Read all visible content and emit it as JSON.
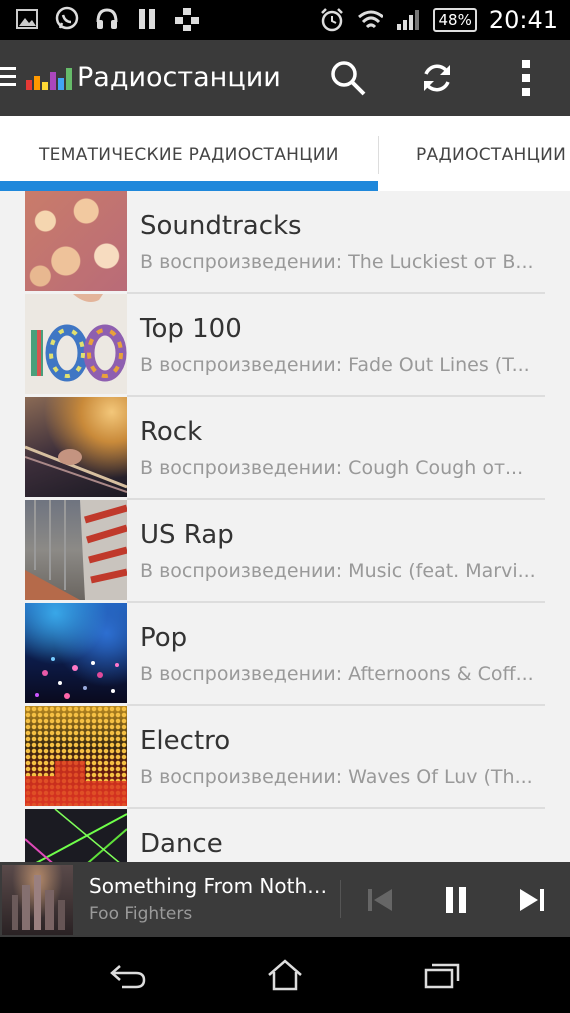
{
  "status_bar": {
    "icons": [
      "image-icon",
      "viber-icon",
      "headphones-icon",
      "pause-icon",
      "network-icon",
      "alarm-icon",
      "wifi-icon",
      "signal-icon"
    ],
    "battery": "48%",
    "time": "20:41"
  },
  "app_bar": {
    "title": "Радиостанции",
    "icons": [
      "menu-icon",
      "deezer-logo",
      "search-icon",
      "refresh-icon",
      "overflow-menu-icon"
    ]
  },
  "tabs": [
    {
      "label": "ТЕМАТИЧЕСКИЕ РАДИОСТАНЦИИ",
      "selected": true
    },
    {
      "label": "РАДИОСТАНЦИИ",
      "selected": false
    }
  ],
  "stations": [
    {
      "title": "Soundtracks",
      "subtitle": "В воспроизведении: The Luckiest от B..."
    },
    {
      "title": "Top 100",
      "subtitle": "В воспроизведении: Fade Out Lines (T..."
    },
    {
      "title": "Rock",
      "subtitle": "В воспроизведении: Cough Cough от..."
    },
    {
      "title": "US Rap",
      "subtitle": "В воспроизведении: Music (feat. Marvi..."
    },
    {
      "title": "Pop",
      "subtitle": "В воспроизведении: Afternoons & Coff..."
    },
    {
      "title": "Electro",
      "subtitle": "В воспроизведении: Waves Of Luv (Th..."
    },
    {
      "title": "Dance",
      "subtitle": ""
    }
  ],
  "player": {
    "track": "Something From Nothi...",
    "artist": "Foo Fighters"
  },
  "colors": {
    "accent": "#1f88db",
    "appbar": "#3a3a3a",
    "player": "#3b3b3b"
  }
}
